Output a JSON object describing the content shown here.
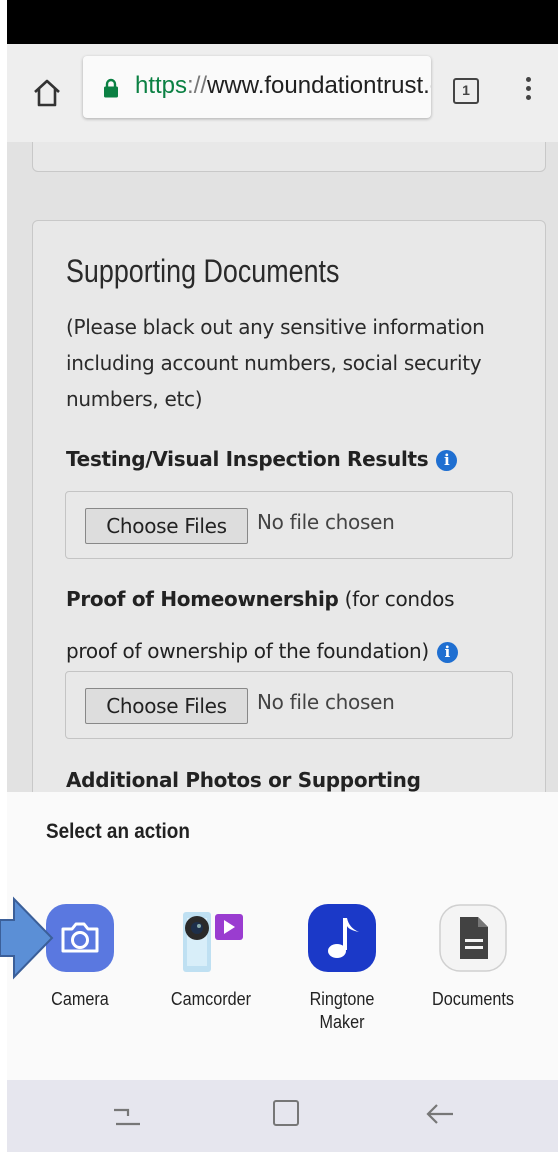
{
  "browser": {
    "url_scheme": "https",
    "url_separator": "://",
    "url_host": "www.foundationtrust.org/apply",
    "tab_count": "1"
  },
  "form": {
    "section_title": "Supporting Documents",
    "section_note": "(Please black out any sensitive information including account numbers, social security numbers, etc)",
    "field1": {
      "label": "Testing/Visual Inspection Results",
      "button": "Choose Files",
      "status": "No file chosen"
    },
    "field2": {
      "label_bold": "Proof of Homeownership",
      "label_normal": " (for condos",
      "label_line2": "proof of ownership of the foundation)",
      "button": "Choose Files",
      "status": "No file chosen"
    },
    "field3": {
      "label": "Additional Photos or Supporting"
    }
  },
  "action_sheet": {
    "title": "Select an action",
    "apps": [
      {
        "label": "Camera",
        "icon": "camera-icon"
      },
      {
        "label": "Camcorder",
        "icon": "camcorder-icon"
      },
      {
        "label_line1": "Ringtone",
        "label_line2": "Maker",
        "icon": "music-note-icon"
      },
      {
        "label": "Documents",
        "icon": "document-icon"
      }
    ]
  },
  "colors": {
    "camera_bg": "#5a78e0",
    "ringtone_bg": "#1b39c8",
    "info_icon": "#1f6fd1",
    "secure_green": "#0b8043",
    "pointer_arrow": "#5b8fd6"
  }
}
